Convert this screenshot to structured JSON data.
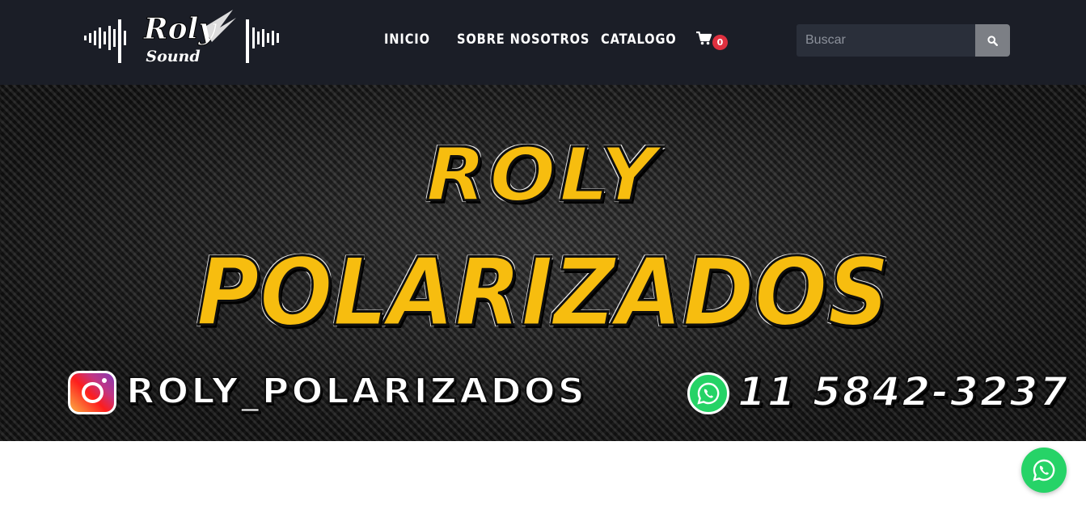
{
  "brand": {
    "logo_line1": "Roly",
    "logo_line2": "Sound"
  },
  "nav": {
    "items": [
      {
        "label": "INICIO"
      },
      {
        "label": "SOBRE NOSOTROS"
      },
      {
        "label": "CATALOGO"
      }
    ]
  },
  "cart": {
    "icon": "cart-icon",
    "count": "0"
  },
  "search": {
    "placeholder": "Buscar",
    "value": "",
    "button_icon": "search-icon"
  },
  "hero": {
    "title_line1": "ROLY",
    "title_line2": "POLARIZADOS",
    "instagram_handle": "ROLY_POLARIZADOS",
    "phone": "11 5842-3237",
    "instagram_icon": "instagram-icon",
    "whatsapp_icon": "whatsapp-icon"
  },
  "floating": {
    "icon": "whatsapp-icon"
  },
  "colors": {
    "header_bg": "#1b1e27",
    "accent_yellow": "#f7bd0f",
    "badge_red": "#e0303f",
    "whatsapp_green": "#26d367"
  }
}
